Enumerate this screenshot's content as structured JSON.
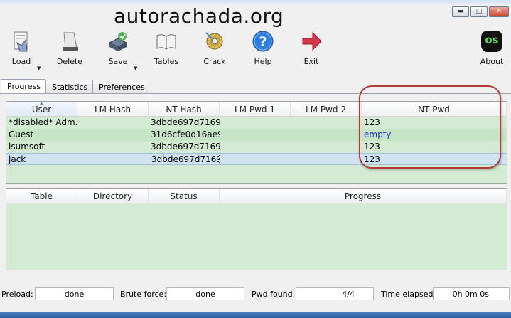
{
  "watermark": "autorachada.org",
  "window_controls": {
    "minimize": "▬",
    "maximize": "□",
    "close": "✕"
  },
  "toolbar": {
    "load": "Load",
    "delete": "Delete",
    "save": "Save",
    "tables": "Tables",
    "crack": "Crack",
    "help": "Help",
    "exit": "Exit",
    "about": "About",
    "about_badge": "os",
    "dropdown_glyph": "▼"
  },
  "tabs": [
    "Progress",
    "Statistics",
    "Preferences"
  ],
  "hash_table": {
    "sort_glyph": "▲",
    "columns": [
      "User",
      "LM Hash",
      "NT Hash",
      "LM Pwd 1",
      "LM Pwd 2",
      "NT Pwd"
    ],
    "rows": [
      [
        "*disabled* Adm...",
        "",
        "3dbde697d7169...",
        "",
        "",
        "123"
      ],
      [
        "Guest",
        "",
        "31d6cfe0d16ae9...",
        "",
        "",
        "empty"
      ],
      [
        "isumsoft",
        "",
        "3dbde697d7169...",
        "",
        "",
        "123"
      ],
      [
        "jack",
        "",
        "3dbde697d7169...",
        "",
        "",
        "123"
      ]
    ]
  },
  "progress_table": {
    "columns": [
      "Table",
      "Directory",
      "Status",
      "Progress"
    ]
  },
  "status": {
    "preload_label": "Preload:",
    "preload_value": "done",
    "brute_label": "Brute force:",
    "brute_value": "done",
    "found_label": "Pwd found:",
    "found_value": "4/4",
    "elapsed_label": "Time elapsed:",
    "elapsed_value": "0h 0m 0s"
  },
  "colors": {
    "table_bg": "#d3ebd3",
    "alt_row": "#c6e4c6",
    "highlight": "#b33a3a",
    "empty_text": "#2233cc"
  }
}
